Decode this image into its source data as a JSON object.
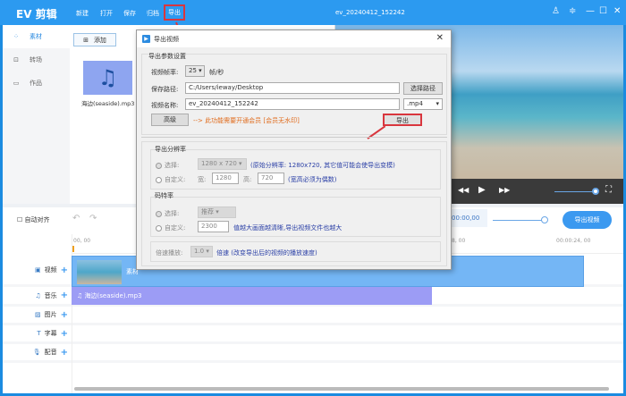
{
  "app": {
    "logo": "EV 剪辑",
    "menu": [
      "新建",
      "打开",
      "保存",
      "归档",
      "导出"
    ],
    "doc_title": "ev_20240412_152242",
    "window_icons": [
      "user-icon",
      "skin-icon",
      "minimize-icon",
      "maximize-icon",
      "close-icon"
    ]
  },
  "sidebar": {
    "items": [
      {
        "label": "素材",
        "icon": "grid-icon"
      },
      {
        "label": "转场",
        "icon": "transition-icon"
      },
      {
        "label": "作品",
        "icon": "folder-icon"
      }
    ]
  },
  "media": {
    "add_label": "添加",
    "items": [
      {
        "name": "海边(seaside).mp3",
        "icon": "music-icon"
      }
    ]
  },
  "preview": {
    "controls": [
      "rewind-icon",
      "play-icon",
      "fast-forward-icon",
      "volume-slider",
      "fullscreen-icon"
    ],
    "volume": 1.0
  },
  "toolbar": {
    "auto_align": "自动对齐",
    "timecode": "00:00,00",
    "export_video": "导出视频",
    "zoom": 0.75
  },
  "timeline": {
    "ruler": [
      "00, 00",
      "8, 00",
      "00:00:24, 00"
    ],
    "tracks": [
      {
        "label": "视频",
        "icon": "video-icon"
      },
      {
        "label": "音乐",
        "icon": "music-icon"
      },
      {
        "label": "图片",
        "icon": "image-icon"
      },
      {
        "label": "字幕",
        "icon": "text-icon"
      },
      {
        "label": "配音",
        "icon": "mic-icon"
      }
    ],
    "video_clip": "素材",
    "audio_clip": "海边(seaside).mp3"
  },
  "dialog": {
    "title": "导出视频",
    "section1": "导出参数设置",
    "fps_label": "视频帧率:",
    "fps": "25",
    "fps_unit": "帧/秒",
    "path_label": "保存路径:",
    "path": "C:/Users/ieway/Desktop",
    "choose_path": "选择路径",
    "name_label": "视频名称:",
    "name": "ev_20240412_152242",
    "format": ".mp4",
    "advanced": "高级",
    "vip_note": "--> 此功能需要开通会员 [会员无水印]",
    "export": "导出",
    "res_section": "导出分辨率",
    "select_label": "选择:",
    "res_value": "1280 x 720",
    "res_note": "(原始分辨率: 1280x720, 其它值可能会使导出变模)",
    "custom_label": "自定义:",
    "width_label": "宽:",
    "width": "1280",
    "height_label": "高:",
    "height": "720",
    "even_note": "(宽高必须为偶数)",
    "bitrate_section": "码特率",
    "bitrate_select": "推荐",
    "bitrate_custom": "2300",
    "bitrate_note": "值越大画面越清晰,导出视频文件也越大",
    "speed_label": "倍速播放:",
    "speed": "1.0",
    "speed_note": "倍速 (改变导出后的视频的播放速度)"
  }
}
